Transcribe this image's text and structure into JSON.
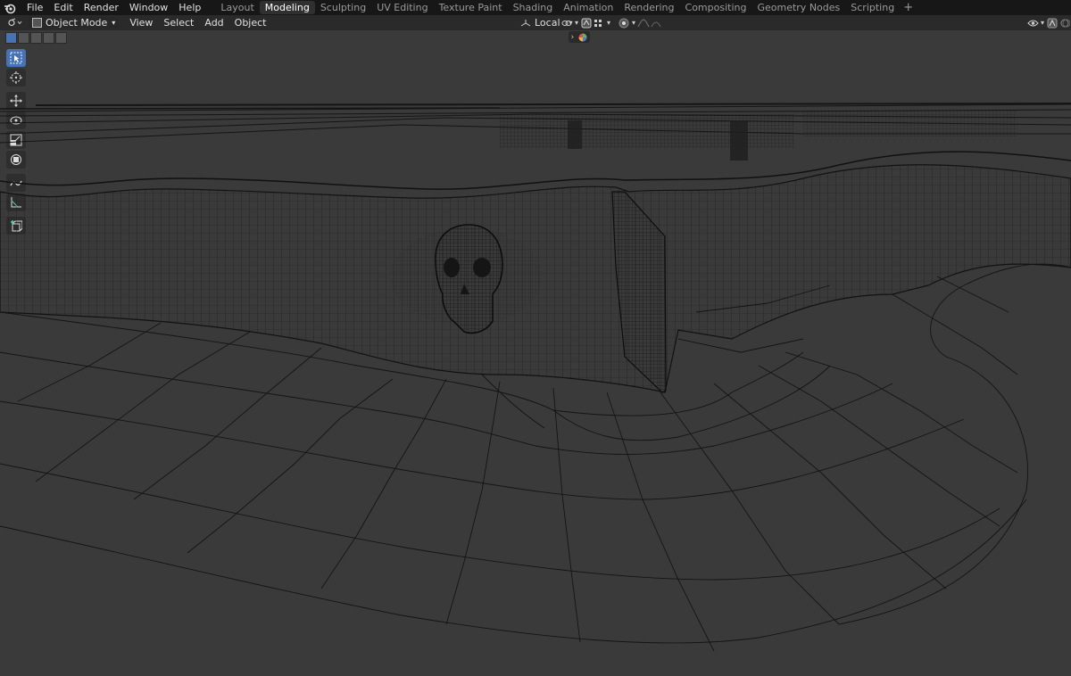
{
  "menubar": {
    "menus": [
      "File",
      "Edit",
      "Render",
      "Window",
      "Help"
    ],
    "workspaces": [
      "Layout",
      "Modeling",
      "Sculpting",
      "UV Editing",
      "Texture Paint",
      "Shading",
      "Animation",
      "Rendering",
      "Compositing",
      "Geometry Nodes",
      "Scripting"
    ],
    "active_workspace": "Modeling",
    "add_symbol": "+"
  },
  "header": {
    "mode": "Object Mode",
    "menus": [
      "View",
      "Select",
      "Add",
      "Object"
    ],
    "orientation": "Local"
  },
  "toolbar": {
    "tools": [
      "select-box",
      "cursor",
      "move",
      "rotate",
      "scale",
      "transform",
      "annotate",
      "measure",
      "add-cube"
    ],
    "active_tool": "select-box"
  },
  "colors": {
    "accent": "#4772b3",
    "viewport_bg": "#3a3a3a",
    "wire": "#111111",
    "topbar": "#171717",
    "header": "#2a2a2a"
  }
}
